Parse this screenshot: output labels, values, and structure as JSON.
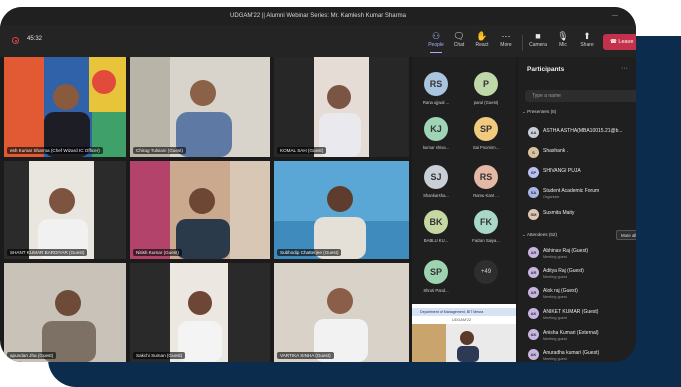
{
  "window": {
    "title": "UDGAM'22 || Alumni Webinar Series: Mr. Kamlesh Kumar Sharma",
    "minimize": "—"
  },
  "toolbar": {
    "timer": "45:32",
    "buttons": [
      {
        "label": "People",
        "icon": "people-icon",
        "glyph": "⚇"
      },
      {
        "label": "Chat",
        "icon": "chat-icon",
        "glyph": "🗨"
      },
      {
        "label": "React",
        "icon": "react-icon",
        "glyph": "✋"
      },
      {
        "label": "More",
        "icon": "more-icon",
        "glyph": "⋯"
      },
      {
        "label": "Camera",
        "icon": "camera-icon",
        "glyph": "■"
      },
      {
        "label": "Mic",
        "icon": "mic-muted-icon",
        "glyph": "🎙"
      },
      {
        "label": "Share",
        "icon": "share-icon",
        "glyph": "⬆"
      }
    ],
    "leave_label": "Leave",
    "leave_glyph": "☎"
  },
  "video_tiles": [
    {
      "name": "esh Kumar Sharma (Chef Wizard IC Officer)"
    },
    {
      "name": "Chirag Tulsiani (Guest)"
    },
    {
      "name": "KOMAL SAH (Guest)"
    },
    {
      "name": "SHANT KUMAR BARDIYAR (Guest)"
    },
    {
      "name": "Nitish Kumar (Guest)"
    },
    {
      "name": "Subhodip Chatterjee (Guest)"
    },
    {
      "name": "apundan Jha (Guest)"
    },
    {
      "name": "Sakchi Suman (Guest)"
    },
    {
      "name": "VARTIKA SINHA (Guest)"
    }
  ],
  "avatars": [
    {
      "initials": "RS",
      "name": "Rana ujjwal ...",
      "color": "#a9c4df"
    },
    {
      "initials": "P",
      "name": "parul (Guest)",
      "color": "#bfd8a8"
    },
    {
      "initials": "KJ",
      "name": "kumar shiva...",
      "color": "#9fd4b6"
    },
    {
      "initials": "SP",
      "name": "Sai Poornim...",
      "color": "#f1c97f"
    },
    {
      "initials": "SJ",
      "name": "Shankarsha...",
      "color": "#c9cfd6"
    },
    {
      "initials": "RS",
      "name": "Ramu Kant ...",
      "color": "#e3b8a4"
    },
    {
      "initials": "BK",
      "name": "BABLU KU...",
      "color": "#c6d7a2"
    },
    {
      "initials": "FK",
      "name": "Faizan Saiya...",
      "color": "#a9d8c9"
    },
    {
      "initials": "SP",
      "name": "Shruti Pand...",
      "color": "#9ed3b0"
    }
  ],
  "more_count": "+49",
  "shared_screen": {
    "title": "Department of Management, BIT Mesra",
    "subtitle": "UDGAM'22"
  },
  "panel": {
    "title": "Participants",
    "dots": "···",
    "search_placeholder": "Type a name",
    "presenters_label": "Presenters (5)",
    "presenters": [
      {
        "initials": "AA",
        "name": "ASTHA ASTHA(MBA10015.21@b...",
        "sub": "",
        "color": "#c9cfd6"
      },
      {
        "initials": "S",
        "name": "Shashank .",
        "sub": "",
        "color": "#d9c2a0"
      },
      {
        "initials": "SP",
        "name": "SHIVANGI PUJA",
        "sub": "",
        "color": "#b8c1f0"
      },
      {
        "initials": "SA",
        "name": "Student Academic Forum",
        "sub": "Organizer",
        "color": "#a9b7e8"
      },
      {
        "initials": "SM",
        "name": "Susmita Maity",
        "sub": "",
        "color": "#e0c7b5"
      }
    ],
    "attendees_label": "Attendees (62)",
    "mute_all": "Mute all",
    "attendees": [
      {
        "initials": "AR",
        "name": "Abhinav Raj (Guest)",
        "sub": "Meeting guest",
        "color": "#c8b6e2"
      },
      {
        "initials": "AR",
        "name": "Aditya Raj (Guest)",
        "sub": "Meeting guest",
        "color": "#c8b6e2"
      },
      {
        "initials": "AR",
        "name": "Alok raj (Guest)",
        "sub": "Meeting guest",
        "color": "#c8b6e2"
      },
      {
        "initials": "AK",
        "name": "ANIKET KUMAR (Guest)",
        "sub": "Meeting guest",
        "color": "#c8b6e2"
      },
      {
        "initials": "AK",
        "name": "Anisha Kumari (External)",
        "sub": "Meeting guest",
        "color": "#c8b6e2"
      },
      {
        "initials": "AK",
        "name": "Anuradha kumari (Guest)",
        "sub": "Meeting guest",
        "color": "#c8b6e2"
      }
    ]
  },
  "colors": {
    "accent": "#a9b0ff",
    "leave": "#c4314b",
    "card": "#0c2c4d"
  }
}
